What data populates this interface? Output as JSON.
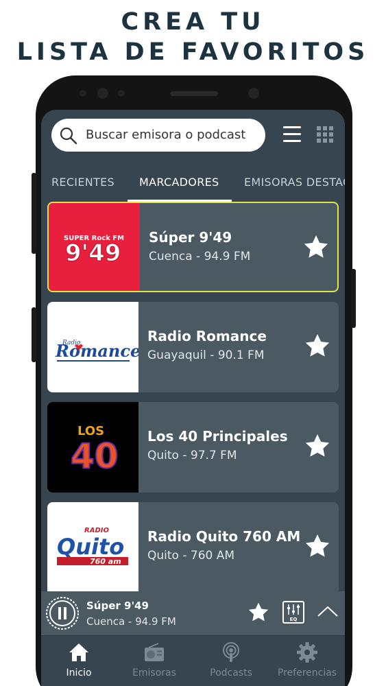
{
  "headline": {
    "line1": "CREA TU",
    "line2": "LISTA DE FAVORITOS"
  },
  "search": {
    "placeholder": "Buscar emisora o podcast"
  },
  "tabs": [
    {
      "label": "RECIENTES"
    },
    {
      "label": "MARCADORES"
    },
    {
      "label": "EMISORAS DESTACADAS"
    }
  ],
  "stations": [
    {
      "name": "Súper 9'49",
      "location": "Cuenca - 94.9 FM",
      "logo": "super-949-logo",
      "logo_text": "9'49",
      "logo_small": "SUPER Rock FM"
    },
    {
      "name": "Radio Romance",
      "location": "Guayaquil - 90.1 FM",
      "logo": "radio-romance-logo",
      "logo_text": "Romance",
      "logo_small": "Radio"
    },
    {
      "name": "Los 40 Principales",
      "location": "Quito - 97.7 FM",
      "logo": "los40-logo",
      "logo_text": "40",
      "logo_small": "LOS"
    },
    {
      "name": "Radio Quito 760 AM",
      "location": "Quito - 760 AM",
      "logo": "radio-quito-logo",
      "logo_text": "Quito",
      "logo_small": "RADIO",
      "logo_tag": "760 am"
    }
  ],
  "player": {
    "title": "Súper 9'49",
    "subtitle": "Cuenca - 94.9 FM",
    "eq_label": "EQ"
  },
  "nav": [
    {
      "label": "Inicio",
      "icon": "home-icon"
    },
    {
      "label": "Emisoras",
      "icon": "radio-icon"
    },
    {
      "label": "Podcasts",
      "icon": "podcast-icon"
    },
    {
      "label": "Preferencias",
      "icon": "gear-icon"
    }
  ],
  "colors": {
    "screen_bg": "#36454f",
    "card_bg": "#4a5962",
    "highlight": "#e2e34a",
    "headline": "#1d3340"
  }
}
